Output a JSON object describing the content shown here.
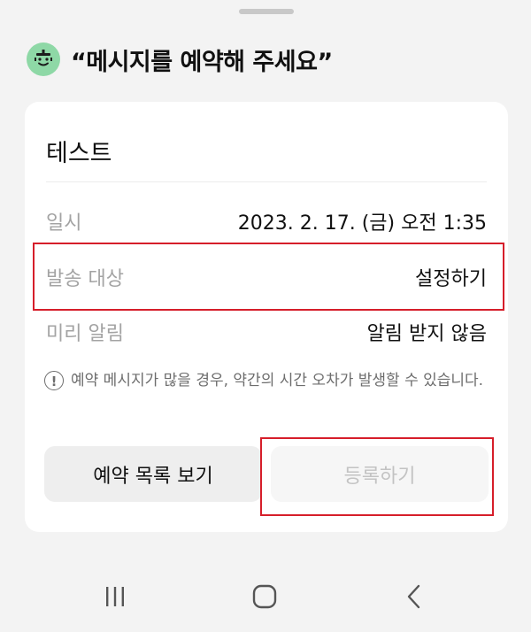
{
  "sheet": {
    "header_title": "“메시지를 예약해 주세요”"
  },
  "card": {
    "title": "테스트",
    "rows": [
      {
        "label": "일시",
        "value": "2023. 2. 17. (금) 오전 1:35"
      },
      {
        "label": "발송 대상",
        "value": "설정하기"
      },
      {
        "label": "미리 알림",
        "value": "알림 받지 않음"
      }
    ],
    "notice": "예약 메시지가 많을 경우, 약간의 시간 오차가 발생할 수 있습니다.",
    "notice_icon_glyph": "!",
    "buttons": {
      "list_label": "예약 목록 보기",
      "register_label": "등록하기"
    }
  },
  "colors": {
    "accent_icon_bg": "#8ed8a6",
    "highlight_border": "#d61e2a",
    "disabled_text": "#c3c3c3"
  },
  "icons": {
    "header": "bot-face-icon",
    "nav": [
      "recent-apps-icon",
      "home-icon",
      "back-icon"
    ]
  }
}
